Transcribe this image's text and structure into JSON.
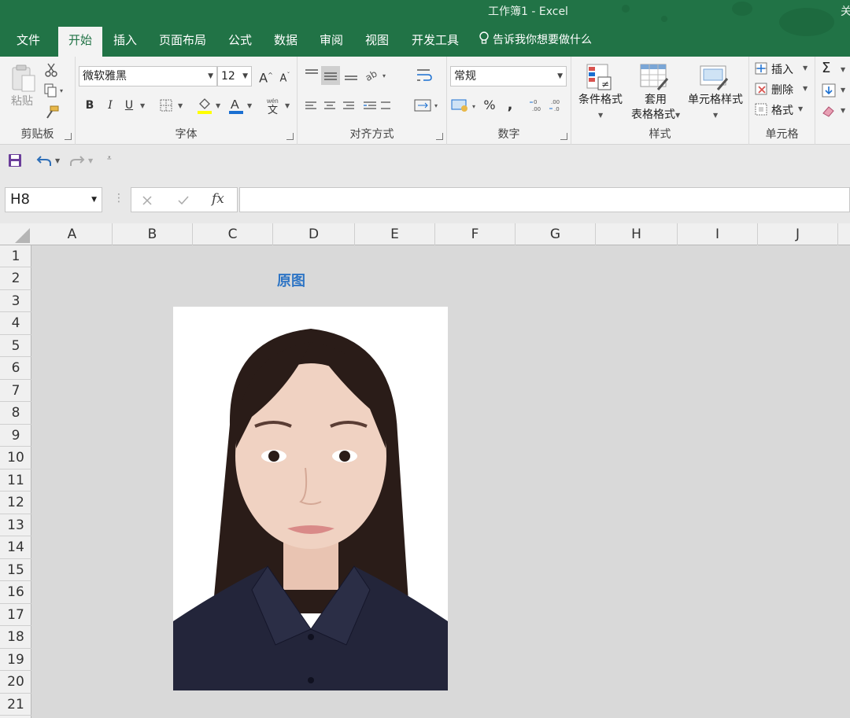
{
  "window": {
    "title": "工作簿1  -  Excel",
    "corner_text": "关"
  },
  "tabs": [
    {
      "label": "文件",
      "active": false
    },
    {
      "label": "开始",
      "active": true
    },
    {
      "label": "插入",
      "active": false
    },
    {
      "label": "页面布局",
      "active": false
    },
    {
      "label": "公式",
      "active": false
    },
    {
      "label": "数据",
      "active": false
    },
    {
      "label": "审阅",
      "active": false
    },
    {
      "label": "视图",
      "active": false
    },
    {
      "label": "开发工具",
      "active": false
    }
  ],
  "tell_me": "告诉我你想要做什么",
  "ribbon": {
    "clipboard": {
      "paste": "粘贴",
      "label": "剪贴板"
    },
    "font": {
      "name": "微软雅黑",
      "size": "12",
      "label": "字体",
      "bold": "B",
      "italic": "I",
      "underline": "U"
    },
    "alignment": {
      "label": "对齐方式"
    },
    "number": {
      "format": "常规",
      "label": "数字",
      "percent": "%",
      "comma": ","
    },
    "styles": {
      "conditional": "条件格式",
      "table_1": "套用",
      "table_2": "表格格式",
      "cell_styles": "单元格样式",
      "label": "样式"
    },
    "cells": {
      "insert": "插入",
      "delete": "删除",
      "format": "格式",
      "label": "单元格"
    },
    "editing": {
      "sum": "Σ"
    }
  },
  "formula_bar": {
    "name_box": "H8",
    "fx": "fx",
    "value": ""
  },
  "columns": [
    "A",
    "B",
    "C",
    "D",
    "E",
    "F",
    "G",
    "H",
    "I",
    "J"
  ],
  "rows": [
    "1",
    "2",
    "3",
    "4",
    "5",
    "6",
    "7",
    "8",
    "9",
    "10",
    "11",
    "12",
    "13",
    "14",
    "15",
    "16",
    "17",
    "18",
    "19",
    "20",
    "21"
  ],
  "sheet": {
    "title_cell": "原图"
  },
  "colors": {
    "brand_green": "#217346",
    "title_blue": "#2e75c5",
    "shirt": "#23253a",
    "hair": "#2a1c18",
    "skin": "#f0d2c2"
  }
}
